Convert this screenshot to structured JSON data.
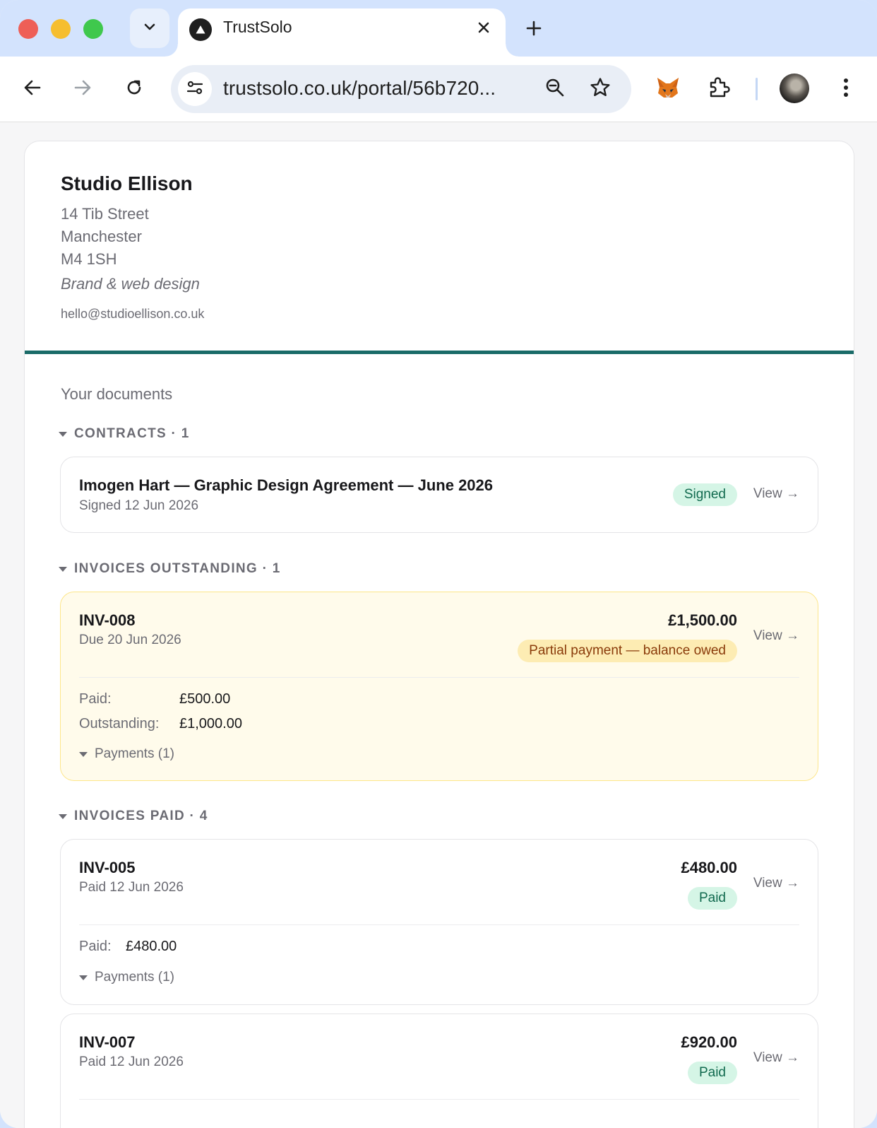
{
  "browser": {
    "tab_title": "TrustSolo",
    "url": "trustsolo.co.uk/portal/56b720..."
  },
  "business": {
    "name": "Studio Ellison",
    "address_line1": "14 Tib Street",
    "address_line2": "Manchester",
    "address_line3": "M4 1SH",
    "tagline": "Brand & web design",
    "email": "hello@studioellison.co.uk"
  },
  "documents_heading": "Your documents",
  "contracts": {
    "heading": "CONTRACTS · 1",
    "items": [
      {
        "title": "Imogen Hart — Graphic Design Agreement — June 2026",
        "subtitle": "Signed 12 Jun 2026",
        "status": "Signed",
        "view": "View →"
      }
    ]
  },
  "outstanding": {
    "heading": "INVOICES OUTSTANDING · 1",
    "items": [
      {
        "number": "INV-008",
        "due": "Due 20 Jun 2026",
        "amount": "£1,500.00",
        "status": "Partial payment — balance owed",
        "view": "View →",
        "paid_label": "Paid:",
        "paid_value": "£500.00",
        "outstanding_label": "Outstanding:",
        "outstanding_value": "£1,000.00",
        "payments": "Payments (1)"
      }
    ]
  },
  "paid": {
    "heading": "INVOICES PAID · 4",
    "items": [
      {
        "number": "INV-005",
        "date": "Paid 12 Jun 2026",
        "amount": "£480.00",
        "status": "Paid",
        "view": "View →",
        "paid_label": "Paid:",
        "paid_value": "£480.00",
        "payments": "Payments (1)"
      },
      {
        "number": "INV-007",
        "date": "Paid 12 Jun 2026",
        "amount": "£920.00",
        "status": "Paid",
        "view": "View →"
      }
    ]
  },
  "colors": {
    "accent": "#1a6b68",
    "badge_green_bg": "#d5f5e6",
    "badge_amber_bg": "#fdecb3",
    "warn_card_bg": "#fffbeb"
  }
}
